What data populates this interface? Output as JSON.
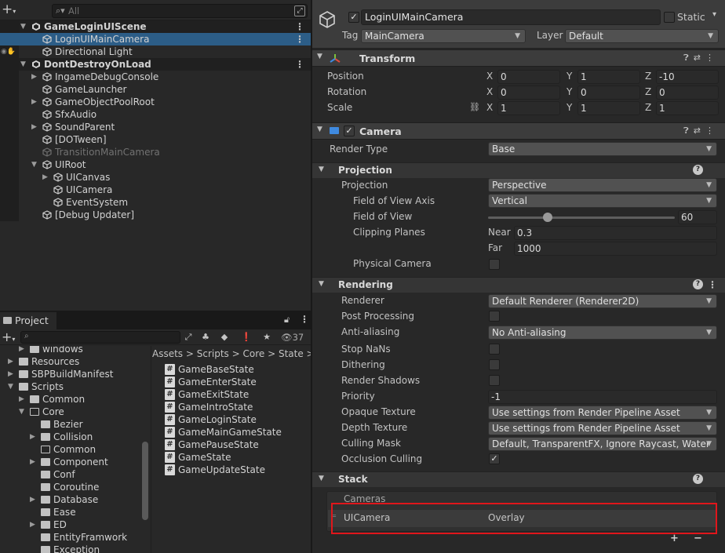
{
  "hierarchy": {
    "search_placeholder": "All",
    "rows": [
      {
        "label": "GameLoginUIScene",
        "kind": "scene"
      },
      {
        "label": "LoginUIMainCamera",
        "kind": "selected"
      },
      {
        "label": "Directional Light",
        "kind": "normal"
      },
      {
        "label": "DontDestroyOnLoad",
        "kind": "scene"
      },
      {
        "label": "IngameDebugConsole",
        "kind": "normal"
      },
      {
        "label": "GameLauncher",
        "kind": "normal"
      },
      {
        "label": "GameObjectPoolRoot",
        "kind": "normal"
      },
      {
        "label": "SfxAudio",
        "kind": "normal"
      },
      {
        "label": "SoundParent",
        "kind": "normal"
      },
      {
        "label": "[DOTween]",
        "kind": "normal"
      },
      {
        "label": "TransitionMainCamera",
        "kind": "inactive"
      },
      {
        "label": "UIRoot",
        "kind": "normal"
      },
      {
        "label": "UICanvas",
        "kind": "normal"
      },
      {
        "label": "UICamera",
        "kind": "normal"
      },
      {
        "label": "EventSystem",
        "kind": "normal"
      },
      {
        "label": "[Debug Updater]",
        "kind": "normal"
      }
    ]
  },
  "project": {
    "tab_label": "Project",
    "hidden_count": "37",
    "folders": [
      "windows",
      "Resources",
      "SBPBuildManifest",
      "Scripts",
      "Common",
      "Core",
      "Bezier",
      "Collision",
      "Common",
      "Component",
      "Conf",
      "Coroutine",
      "Database",
      "Ease",
      "ED",
      "EntityFramwork",
      "Exception"
    ],
    "breadcrumb": [
      "Assets",
      "Scripts",
      "Core",
      "State"
    ],
    "files": [
      "GameBaseState",
      "GameEnterState",
      "GameExitState",
      "GameIntroState",
      "GameLoginState",
      "GameMainGameState",
      "GamePauseState",
      "GameState",
      "GameUpdateState"
    ]
  },
  "inspector": {
    "object_name": "LoginUIMainCamera",
    "static_label": "Static",
    "tag_label": "Tag",
    "tag_value": "MainCamera",
    "layer_label": "Layer",
    "layer_value": "Default",
    "transform": {
      "title": "Transform",
      "position_label": "Position",
      "position": [
        "0",
        "1",
        "-10"
      ],
      "rotation_label": "Rotation",
      "rotation": [
        "0",
        "0",
        "0"
      ],
      "scale_label": "Scale",
      "scale": [
        "1",
        "1",
        "1"
      ],
      "axes": [
        "X",
        "Y",
        "Z"
      ]
    },
    "camera": {
      "title": "Camera",
      "render_type_label": "Render Type",
      "render_type": "Base",
      "projection_section": "Projection",
      "projection_label": "Projection",
      "projection": "Perspective",
      "fov_axis_label": "Field of View Axis",
      "fov_axis": "Vertical",
      "fov_label": "Field of View",
      "fov": "60",
      "fov_fraction": 0.32,
      "clipping_label": "Clipping Planes",
      "near_label": "Near",
      "near": "0.3",
      "far_label": "Far",
      "far": "1000",
      "physical_label": "Physical Camera",
      "rendering_section": "Rendering",
      "renderer_label": "Renderer",
      "renderer": "Default Renderer (Renderer2D)",
      "post_label": "Post Processing",
      "aa_label": "Anti-aliasing",
      "aa": "No Anti-aliasing",
      "stopnans_label": "Stop NaNs",
      "dither_label": "Dithering",
      "shadows_label": "Render Shadows",
      "priority_label": "Priority",
      "priority": "-1",
      "opaque_label": "Opaque Texture",
      "opaque": "Use settings from Render Pipeline Asset",
      "depth_label": "Depth Texture",
      "depth": "Use settings from Render Pipeline Asset",
      "culling_label": "Culling Mask",
      "culling": "Default, TransparentFX, Ignore Raycast, Water",
      "occlusion_label": "Occlusion Culling",
      "stack_section": "Stack",
      "stack_header": "Cameras",
      "stack_camera": "UICamera",
      "stack_camera_type": "Overlay",
      "add_label": "+",
      "remove_label": "−"
    }
  },
  "colors": {
    "selection": "#2c5d87",
    "highlight": "#e0161b"
  }
}
